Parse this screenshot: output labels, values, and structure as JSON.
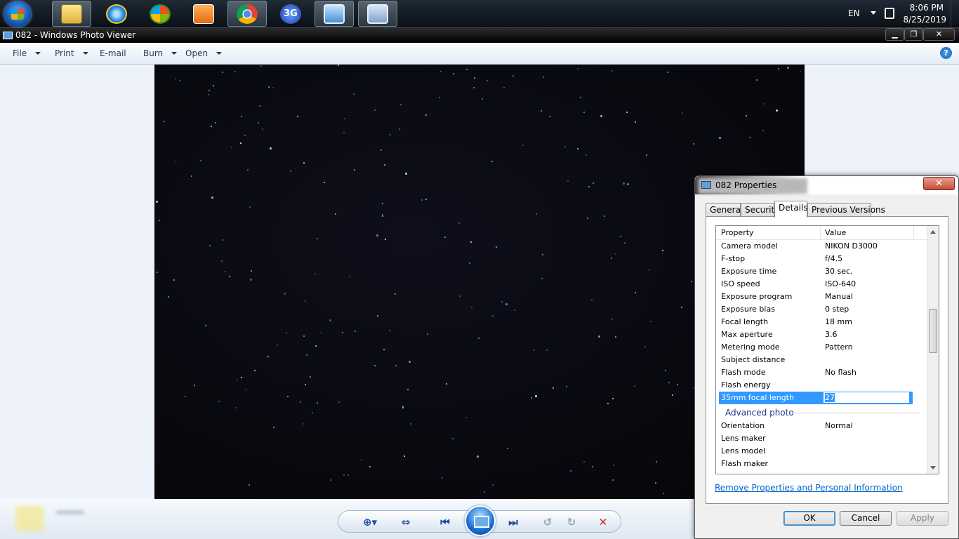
{
  "taskbar": {
    "icons": [
      "start-orb",
      "file-explorer-icon",
      "internet-explorer-icon",
      "windows-media-center-icon",
      "media-player-icon",
      "chrome-icon",
      "3g-modem-icon",
      "photo-viewer-icon",
      "properties-window-icon"
    ],
    "tray": {
      "language": "EN",
      "time": "8:06 PM",
      "date": "8/25/2019"
    }
  },
  "viewer": {
    "title": "082 - Windows Photo Viewer",
    "window_buttons": {
      "minimize": "▁",
      "maximize": "❐",
      "close": "✕"
    },
    "menu": [
      {
        "label": "File",
        "has_dropdown": true
      },
      {
        "label": "Print",
        "has_dropdown": true
      },
      {
        "label": "E-mail",
        "has_dropdown": false
      },
      {
        "label": "Burn",
        "has_dropdown": true
      },
      {
        "label": "Open",
        "has_dropdown": true
      }
    ],
    "help": "?",
    "controls": {
      "zoom": "⊕▾",
      "actual_size": "⇔",
      "previous": "⏮",
      "next": "⏭",
      "rotate_ccw": "↺",
      "rotate_cw": "↻",
      "delete": "✕"
    }
  },
  "dialog": {
    "title": "082 Properties",
    "close": "✕",
    "tabs": [
      "General",
      "Security",
      "Details",
      "Previous Versions"
    ],
    "selected_tab": "Details",
    "columns": {
      "property": "Property",
      "value": "Value"
    },
    "rows": [
      {
        "property": "Camera model",
        "value": "NIKON D3000"
      },
      {
        "property": "F-stop",
        "value": "f/4.5"
      },
      {
        "property": "Exposure time",
        "value": "30 sec."
      },
      {
        "property": "ISO speed",
        "value": "ISO-640"
      },
      {
        "property": "Exposure program",
        "value": "Manual"
      },
      {
        "property": "Exposure bias",
        "value": "0 step"
      },
      {
        "property": "Focal length",
        "value": "18 mm"
      },
      {
        "property": "Max aperture",
        "value": "3.6"
      },
      {
        "property": "Metering mode",
        "value": "Pattern"
      },
      {
        "property": "Subject distance",
        "value": ""
      },
      {
        "property": "Flash mode",
        "value": "No flash"
      },
      {
        "property": "Flash energy",
        "value": ""
      },
      {
        "property": "35mm focal length",
        "value": "27",
        "selected": true
      }
    ],
    "group": "Advanced photo",
    "advanced_rows": [
      {
        "property": "Orientation",
        "value": "Normal"
      },
      {
        "property": "Lens maker",
        "value": ""
      },
      {
        "property": "Lens model",
        "value": ""
      },
      {
        "property": "Flash maker",
        "value": ""
      }
    ],
    "remove_link": "Remove Properties and Personal Information",
    "buttons": {
      "ok": "OK",
      "cancel": "Cancel",
      "apply": "Apply"
    }
  },
  "colors": {
    "selection": "#3399ff",
    "link": "#0066cc",
    "group_header": "#1e3287"
  }
}
